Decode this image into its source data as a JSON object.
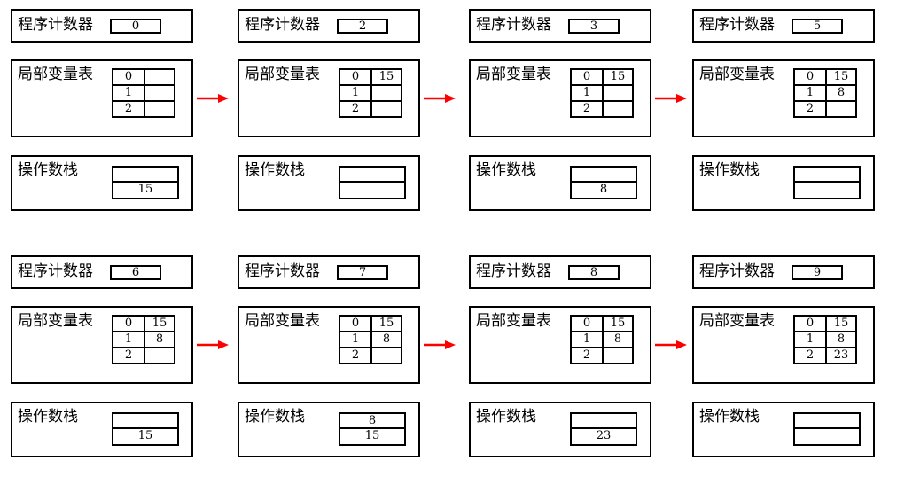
{
  "labels": {
    "pc": "程序计数器",
    "locals": "局部变量表",
    "stack": "操作数栈"
  },
  "frames": [
    {
      "pc": "0",
      "locals": [
        [
          "0",
          ""
        ],
        [
          "1",
          ""
        ],
        [
          "2",
          ""
        ]
      ],
      "stack": [
        "",
        "15"
      ]
    },
    {
      "pc": "2",
      "locals": [
        [
          "0",
          "15"
        ],
        [
          "1",
          ""
        ],
        [
          "2",
          ""
        ]
      ],
      "stack": [
        "",
        ""
      ]
    },
    {
      "pc": "3",
      "locals": [
        [
          "0",
          "15"
        ],
        [
          "1",
          ""
        ],
        [
          "2",
          ""
        ]
      ],
      "stack": [
        "",
        "8"
      ]
    },
    {
      "pc": "5",
      "locals": [
        [
          "0",
          "15"
        ],
        [
          "1",
          "8"
        ],
        [
          "2",
          ""
        ]
      ],
      "stack": [
        "",
        ""
      ]
    },
    {
      "pc": "6",
      "locals": [
        [
          "0",
          "15"
        ],
        [
          "1",
          "8"
        ],
        [
          "2",
          ""
        ]
      ],
      "stack": [
        "",
        "15"
      ]
    },
    {
      "pc": "7",
      "locals": [
        [
          "0",
          "15"
        ],
        [
          "1",
          "8"
        ],
        [
          "2",
          ""
        ]
      ],
      "stack": [
        "8",
        "15"
      ]
    },
    {
      "pc": "8",
      "locals": [
        [
          "0",
          "15"
        ],
        [
          "1",
          "8"
        ],
        [
          "2",
          ""
        ]
      ],
      "stack": [
        "",
        "23"
      ]
    },
    {
      "pc": "9",
      "locals": [
        [
          "0",
          "15"
        ],
        [
          "1",
          "8"
        ],
        [
          "2",
          "23"
        ]
      ],
      "stack": [
        "",
        ""
      ]
    }
  ],
  "colors": {
    "arrow": "#ff0000",
    "border": "#000000"
  },
  "icons": {
    "transition": "red-right-arrow"
  }
}
